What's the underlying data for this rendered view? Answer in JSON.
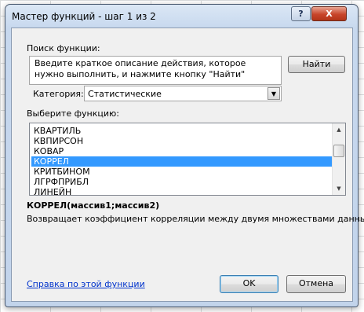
{
  "window": {
    "title": "Мастер функций - шаг 1 из 2",
    "help_glyph": "?",
    "close_glyph": "X"
  },
  "search": {
    "label": "Поиск функции:",
    "text": "Введите краткое описание действия, которое нужно выполнить, и нажмите кнопку \"Найти\"",
    "find_button": "Найти"
  },
  "category": {
    "label": "Категория:",
    "value": "Статистические"
  },
  "functions": {
    "label": "Выберите функцию:",
    "items": [
      "КВАРТИЛЬ",
      "КВПИРСОН",
      "КОВАР",
      "КОРРЕЛ",
      "КРИТБИНОМ",
      "ЛГРФПРИБЛ",
      "ЛИНЕЙН"
    ],
    "selected": "КОРРЕЛ"
  },
  "details": {
    "signature": "КОРРЕЛ(массив1;массив2)",
    "description": "Возвращает коэффициент корреляции между двумя множествами данных."
  },
  "footer": {
    "help_link": "Справка по этой функции",
    "ok": "OK",
    "cancel": "Отмена"
  },
  "colors": {
    "selection": "#3399ff",
    "link": "#0033cc",
    "close_button": "#c8452a"
  }
}
